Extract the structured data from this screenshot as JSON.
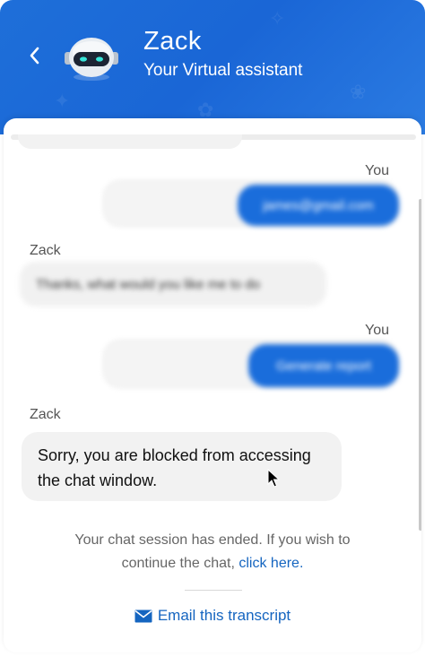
{
  "header": {
    "title": "Zack",
    "subtitle": "Your Virtual assistant",
    "back_icon": "chevron-left-icon",
    "avatar_icon": "robot-icon",
    "background_color": "#1a66d6"
  },
  "messages": [
    {
      "sender": "You",
      "text": "james@gmail.com",
      "blurred": true
    },
    {
      "sender": "Zack",
      "text": "Thanks, what would you like me to do",
      "blurred": true
    },
    {
      "sender": "You",
      "text": "Generate report",
      "blurred": true
    },
    {
      "sender": "Zack",
      "text": "Sorry, you are blocked from accessing the chat window.",
      "blurred": false
    }
  ],
  "footer": {
    "ended_text": "Your chat session has ended. If you wish to continue the chat,",
    "click_here": "click here",
    "period": ".",
    "email_label": "Email this transcript",
    "email_icon": "envelope-icon",
    "link_color": "#1565c0"
  }
}
